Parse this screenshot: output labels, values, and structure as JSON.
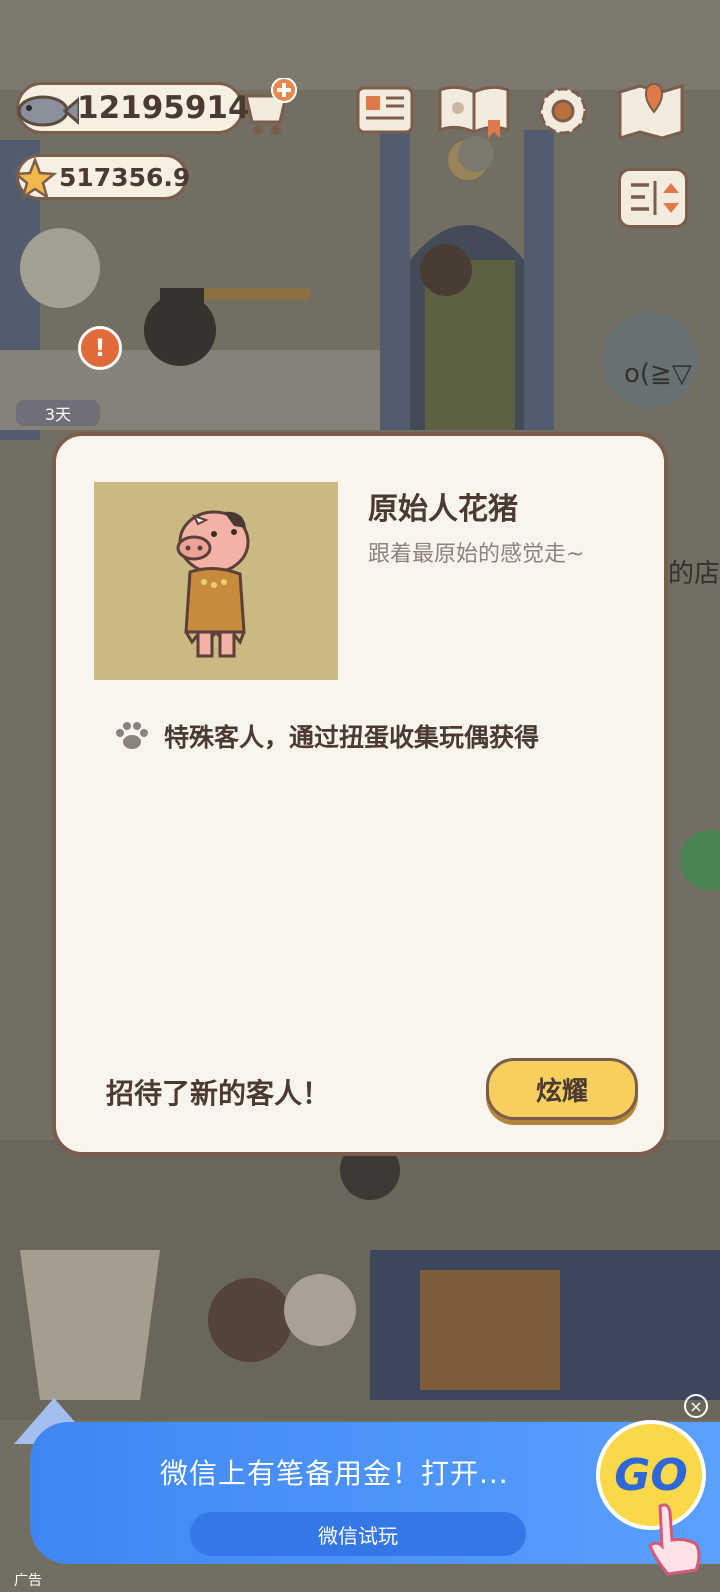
{
  "hud": {
    "fish_count": "12195914",
    "star_count": "517356.9",
    "cat_badge_days": "3天"
  },
  "scene_text": {
    "bubble_emote": "o(≧▽",
    "partial_text": "的店"
  },
  "modal": {
    "character_name": "原始人花猪",
    "character_desc": "跟着最原始的感觉走~",
    "note": "特殊客人，通过扭蛋收集玩偶获得",
    "footer_text": "招待了新的客人！",
    "show_button": "炫耀"
  },
  "ad": {
    "headline": "微信上有笔备用金！打开...",
    "button": "微信试玩",
    "go_label": "GO",
    "ad_tag": "广告"
  },
  "colors": {
    "panel_border": "#7b5d4c",
    "panel_bg": "#faf5ec",
    "button_yellow": "#f6cf5e",
    "ad_blue": "#3f86f2"
  }
}
